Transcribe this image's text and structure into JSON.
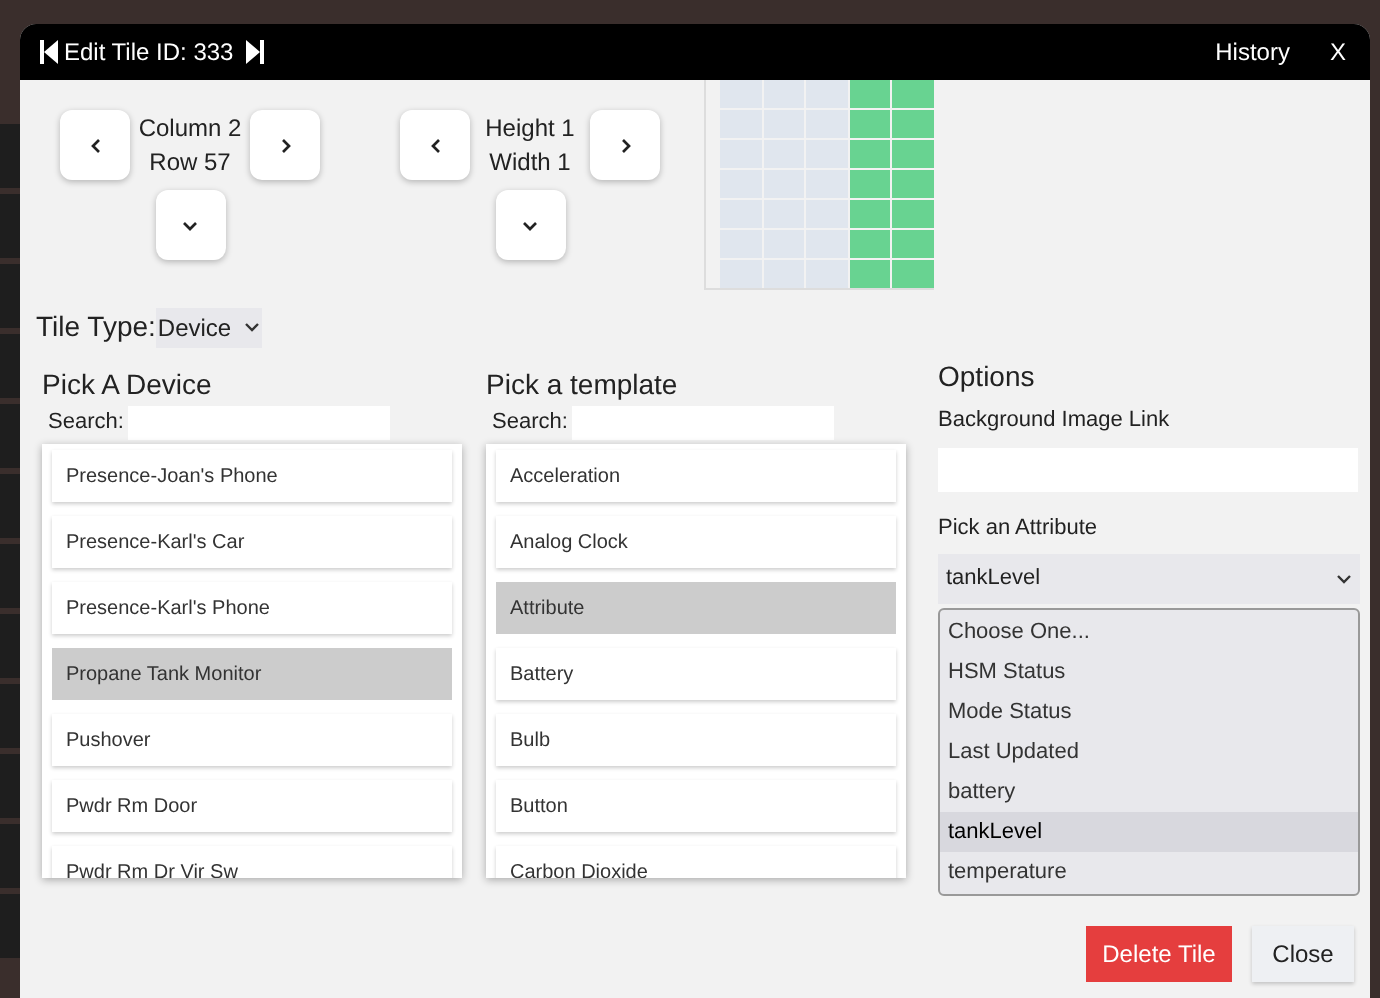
{
  "window": {
    "title": "Edit Tile ID: 333",
    "links": [
      "History",
      "X"
    ]
  },
  "position": {
    "lines": [
      "Column 2",
      "Row 57"
    ]
  },
  "size": {
    "lines": [
      "Height 1",
      "Width 1"
    ]
  },
  "preview": {
    "columns": [
      {
        "selected": false
      },
      {
        "selected": false
      },
      {
        "selected": false
      },
      {
        "selected": true
      },
      {
        "selected": true
      }
    ]
  },
  "tile_type": {
    "label": "Tile Type:",
    "value": "Device"
  },
  "devices": {
    "title": "Pick A Device",
    "search_label": "Search:",
    "items": [
      {
        "label": "Presence-Joan's Phone",
        "selected": false
      },
      {
        "label": "Presence-Karl's Car",
        "selected": false
      },
      {
        "label": "Presence-Karl's Phone",
        "selected": false
      },
      {
        "label": "Propane Tank Monitor",
        "selected": true
      },
      {
        "label": "Pushover",
        "selected": false
      },
      {
        "label": "Pwdr Rm Door",
        "selected": false
      },
      {
        "label": "Pwdr Rm Dr Vir Sw",
        "selected": false
      }
    ]
  },
  "templates": {
    "title": "Pick a template",
    "search_label": "Search:",
    "items": [
      {
        "label": "Acceleration",
        "selected": false
      },
      {
        "label": "Analog Clock",
        "selected": false
      },
      {
        "label": "Attribute",
        "selected": true
      },
      {
        "label": "Battery",
        "selected": false
      },
      {
        "label": "Bulb",
        "selected": false
      },
      {
        "label": "Button",
        "selected": false
      },
      {
        "label": "Carbon Dioxide",
        "selected": false
      }
    ]
  },
  "options": {
    "title": "Options",
    "background_label": "Background Image Link",
    "attribute_label": "Pick an Attribute",
    "attribute_value": "tankLevel",
    "attribute_options": [
      {
        "label": "Choose One...",
        "selected": false
      },
      {
        "label": "HSM Status",
        "selected": false
      },
      {
        "label": "Mode Status",
        "selected": false
      },
      {
        "label": "Last Updated",
        "selected": false
      },
      {
        "label": "battery",
        "selected": false
      },
      {
        "label": "tankLevel",
        "selected": true
      },
      {
        "label": "temperature",
        "selected": false
      }
    ]
  },
  "buttons": [
    {
      "label": "Delete Tile",
      "kind": "danger"
    },
    {
      "label": "Close",
      "kind": "default"
    }
  ]
}
